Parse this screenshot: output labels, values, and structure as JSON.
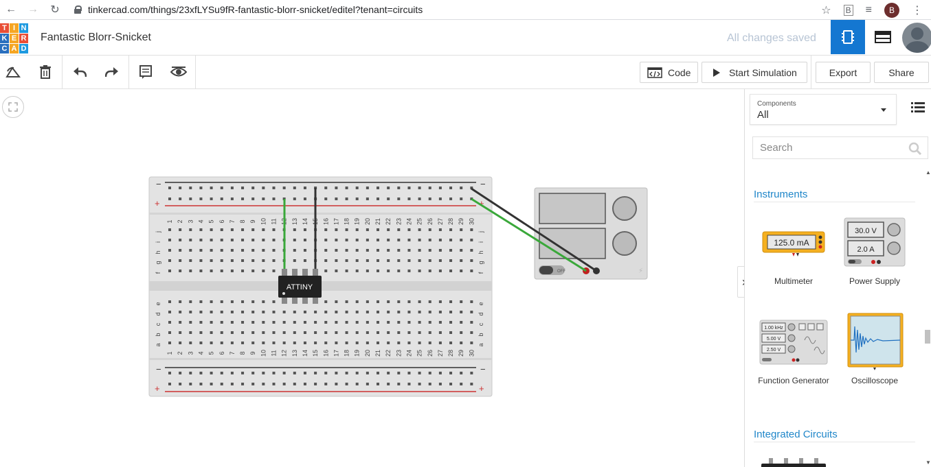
{
  "browser": {
    "url": "tinkercad.com/things/23xfLYSu9fR-fantastic-blorr-snicket/editel?tenant=circuits",
    "profile_initial": "B"
  },
  "app": {
    "logo_letters": [
      "T",
      "I",
      "N",
      "K",
      "E",
      "R",
      "C",
      "A",
      "D"
    ],
    "logo_colors": [
      "#e94e35",
      "#f6a623",
      "#1e9ae0",
      "#2a6fbe",
      "#f6a623",
      "#e94e35",
      "#2a6fbe",
      "#f6a623",
      "#1e9ae0"
    ],
    "project_title": "Fantastic Blorr-Snicket",
    "save_status": "All changes saved",
    "accent_color": "#1477d1"
  },
  "toolbar": {
    "code_label": "Code",
    "start_simulation_label": "Start Simulation",
    "export_label": "Export",
    "share_label": "Share"
  },
  "breadboard": {
    "column_numbers": [
      "1",
      "2",
      "3",
      "4",
      "5",
      "6",
      "7",
      "8",
      "9",
      "10",
      "11",
      "12",
      "13",
      "14",
      "15",
      "16",
      "17",
      "18",
      "19",
      "20",
      "21",
      "22",
      "23",
      "24",
      "25",
      "26",
      "27",
      "28",
      "29",
      "30"
    ],
    "top_row_letters": [
      "j",
      "i",
      "h",
      "g",
      "f"
    ],
    "bottom_row_letters": [
      "e",
      "d",
      "c",
      "b",
      "a"
    ],
    "minus_sign": "−",
    "plus_sign": "+"
  },
  "chip": {
    "label": "ATTINY"
  },
  "power_supply_canvas": {
    "switch_label": "OFF"
  },
  "panel": {
    "components_label": "Components",
    "components_value": "All",
    "search_placeholder": "Search",
    "section_instruments": "Instruments",
    "section_integrated": "Integrated Circuits",
    "multimeter": {
      "label": "Multimeter",
      "reading": "125.0 mA"
    },
    "power_supply": {
      "label": "Power Supply",
      "voltage": "30.0 V",
      "current": "2.0 A"
    },
    "function_generator": {
      "label": "Function Generator",
      "freq": "1.00 kHz",
      "amp": "5.00 V",
      "offset": "2.50 V"
    },
    "oscilloscope": {
      "label": "Oscilloscope"
    }
  }
}
